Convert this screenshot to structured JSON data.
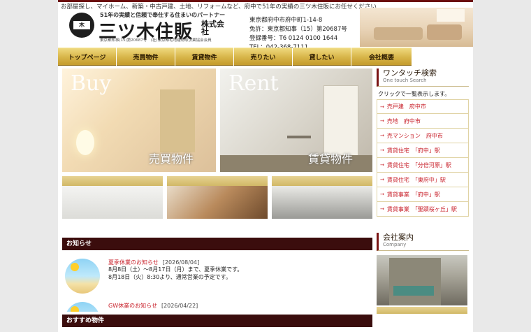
{
  "header": {
    "tagline": "お部屋探し、マイホーム、新築・中古戸建、土地、リフォームなど、府中で51年の実績の三ツ木住販にお任せください",
    "sub_catch": "51年の実績と信頼で奉仕する住まいのパートナー",
    "logo_mark_text": "木",
    "brand_name": "三ツ木住販",
    "brand_suffix": "株式会社",
    "license_small": "東京都知事(15)第20687号　(社)東京都宅地建物取引業協会会員",
    "address": "東京都府中市府中町1-14-8",
    "license": "免許：東京都知事（15）第20687号",
    "registration": "登録番号：T6 0124 0100 1644",
    "tel": "TEL：042-368-7111"
  },
  "nav": {
    "items": [
      {
        "label": "トップページ"
      },
      {
        "label": "売買物件"
      },
      {
        "label": "賃貸物件"
      },
      {
        "label": "売りたい"
      },
      {
        "label": "貸したい"
      },
      {
        "label": "会社概要"
      }
    ]
  },
  "hero": {
    "buy_title": "Buy",
    "buy_label": "売買物件",
    "rent_title": "Rent",
    "rent_label": "賃貸物件"
  },
  "news": {
    "header": "お知らせ",
    "items": [
      {
        "title": "夏季休業のお知らせ",
        "date": "[2026/08/04]",
        "line1": "8月8日（土）～8月17日（月）まで、夏季休業です。",
        "line2": "8月18日（火）8:30より、通常営業の予定です。"
      },
      {
        "title": "GW休業のお知らせ",
        "date": "[2026/04/22]",
        "line1": "",
        "line2": ""
      }
    ]
  },
  "recommend": {
    "header": "おすすめ物件"
  },
  "sidebar": {
    "onetouch_title": "ワンタッチ検索",
    "onetouch_sub": "One touch Search",
    "onetouch_note": "クリックで一覧表示します。",
    "onetouch_items": [
      {
        "label": "売戸建　府中市"
      },
      {
        "label": "売地　府中市"
      },
      {
        "label": "売マンション　府中市"
      },
      {
        "label": "賃貸住宅　「府中」駅"
      },
      {
        "label": "賃貸住宅　「分倍河原」駅"
      },
      {
        "label": "賃貸住宅　「東府中」駅"
      },
      {
        "label": "賃貸事業　「府中」駅"
      },
      {
        "label": "賃貸事業　「聖蹟桜ヶ丘」駅"
      }
    ],
    "company_title": "会社案内",
    "company_sub": "Company"
  },
  "colors": {
    "brand_dark": "#3b0d0d",
    "gold": "#d7b448",
    "link_red": "#c8202a"
  }
}
